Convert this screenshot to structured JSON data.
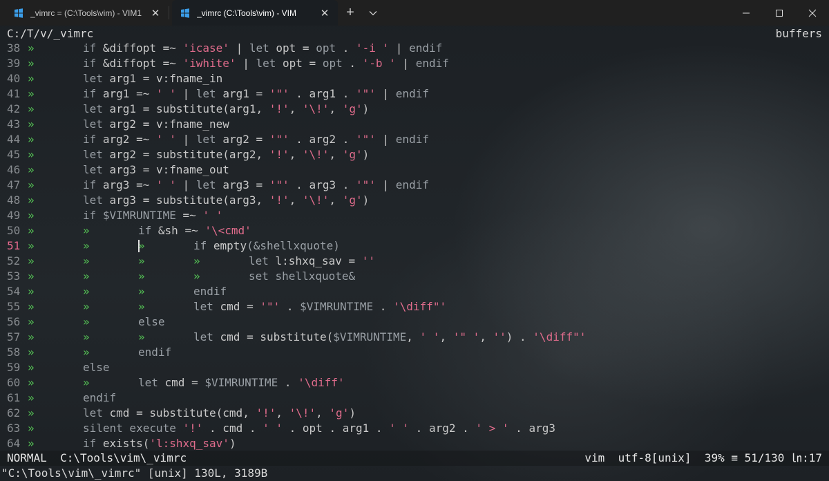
{
  "window": {
    "tabs": [
      {
        "title": "_vimrc = (C:\\Tools\\vim) - VIM1",
        "active": false
      },
      {
        "title": "_vimrc (C:\\Tools\\vim) - VIM",
        "active": true
      }
    ],
    "new_tab_glyph": "+",
    "dropdown_glyph": "⌄",
    "close_glyph": "✕",
    "minimize_glyph": "—",
    "maximize_glyph": "☐",
    "window_close_glyph": "✕"
  },
  "vim": {
    "tabline_path": "C:/T/v/_vimrc",
    "tabline_right": "buffers",
    "guide_glyph": "»",
    "current_line": 51,
    "lines": [
      {
        "n": "38",
        "g": 1,
        "seg": [
          [
            "kw",
            "if "
          ],
          [
            "cmd",
            "&diffopt =~ "
          ],
          [
            "str",
            "'icase'"
          ],
          [
            "cmd",
            " | "
          ],
          [
            "kw",
            "let"
          ],
          [
            "cmd",
            " opt = "
          ],
          [
            "kw",
            "opt"
          ],
          [
            "cmd",
            " . "
          ],
          [
            "str",
            "'-i '"
          ],
          [
            "cmd",
            " | "
          ],
          [
            "kw",
            "endif"
          ]
        ]
      },
      {
        "n": "39",
        "g": 1,
        "seg": [
          [
            "kw",
            "if "
          ],
          [
            "cmd",
            "&diffopt =~ "
          ],
          [
            "str",
            "'iwhite'"
          ],
          [
            "cmd",
            " | "
          ],
          [
            "kw",
            "let"
          ],
          [
            "cmd",
            " opt = "
          ],
          [
            "kw",
            "opt"
          ],
          [
            "cmd",
            " . "
          ],
          [
            "str",
            "'-b '"
          ],
          [
            "cmd",
            " | "
          ],
          [
            "kw",
            "endif"
          ]
        ]
      },
      {
        "n": "40",
        "g": 1,
        "seg": [
          [
            "kw",
            "let "
          ],
          [
            "cmd",
            "arg1 = v:fname_in"
          ]
        ]
      },
      {
        "n": "41",
        "g": 1,
        "seg": [
          [
            "kw",
            "if "
          ],
          [
            "cmd",
            "arg1 =~ "
          ],
          [
            "str",
            "' '"
          ],
          [
            "cmd",
            " | "
          ],
          [
            "kw",
            "let"
          ],
          [
            "cmd",
            " arg1 = "
          ],
          [
            "str",
            "'\"'"
          ],
          [
            "cmd",
            " . arg1 . "
          ],
          [
            "str",
            "'\"'"
          ],
          [
            "cmd",
            " | "
          ],
          [
            "kw",
            "endif"
          ]
        ]
      },
      {
        "n": "42",
        "g": 1,
        "seg": [
          [
            "kw",
            "let "
          ],
          [
            "cmd",
            "arg1 = substitute(arg1, "
          ],
          [
            "str",
            "'!'"
          ],
          [
            "cmd",
            ", "
          ],
          [
            "str",
            "'\\!'"
          ],
          [
            "cmd",
            ", "
          ],
          [
            "str",
            "'g'"
          ],
          [
            "cmd",
            ")"
          ]
        ]
      },
      {
        "n": "43",
        "g": 1,
        "seg": [
          [
            "kw",
            "let "
          ],
          [
            "cmd",
            "arg2 = v:fname_new"
          ]
        ]
      },
      {
        "n": "44",
        "g": 1,
        "seg": [
          [
            "kw",
            "if "
          ],
          [
            "cmd",
            "arg2 =~ "
          ],
          [
            "str",
            "' '"
          ],
          [
            "cmd",
            " | "
          ],
          [
            "kw",
            "let"
          ],
          [
            "cmd",
            " arg2 = "
          ],
          [
            "str",
            "'\"'"
          ],
          [
            "cmd",
            " . arg2 . "
          ],
          [
            "str",
            "'\"'"
          ],
          [
            "cmd",
            " | "
          ],
          [
            "kw",
            "endif"
          ]
        ]
      },
      {
        "n": "45",
        "g": 1,
        "seg": [
          [
            "kw",
            "let "
          ],
          [
            "cmd",
            "arg2 = substitute(arg2, "
          ],
          [
            "str",
            "'!'"
          ],
          [
            "cmd",
            ", "
          ],
          [
            "str",
            "'\\!'"
          ],
          [
            "cmd",
            ", "
          ],
          [
            "str",
            "'g'"
          ],
          [
            "cmd",
            ")"
          ]
        ]
      },
      {
        "n": "46",
        "g": 1,
        "seg": [
          [
            "kw",
            "let "
          ],
          [
            "cmd",
            "arg3 = v:fname_out"
          ]
        ]
      },
      {
        "n": "47",
        "g": 1,
        "seg": [
          [
            "kw",
            "if "
          ],
          [
            "cmd",
            "arg3 =~ "
          ],
          [
            "str",
            "' '"
          ],
          [
            "cmd",
            " | "
          ],
          [
            "kw",
            "let"
          ],
          [
            "cmd",
            " arg3 = "
          ],
          [
            "str",
            "'\"'"
          ],
          [
            "cmd",
            " . arg3 . "
          ],
          [
            "str",
            "'\"'"
          ],
          [
            "cmd",
            " | "
          ],
          [
            "kw",
            "endif"
          ]
        ]
      },
      {
        "n": "48",
        "g": 1,
        "seg": [
          [
            "kw",
            "let "
          ],
          [
            "cmd",
            "arg3 = substitute(arg3, "
          ],
          [
            "str",
            "'!'"
          ],
          [
            "cmd",
            ", "
          ],
          [
            "str",
            "'\\!'"
          ],
          [
            "cmd",
            ", "
          ],
          [
            "str",
            "'g'"
          ],
          [
            "cmd",
            ")"
          ]
        ]
      },
      {
        "n": "49",
        "g": 1,
        "seg": [
          [
            "kw",
            "if "
          ],
          [
            "kw",
            "$VIMRUNTIME"
          ],
          [
            "cmd",
            " =~ "
          ],
          [
            "str",
            "' '"
          ]
        ]
      },
      {
        "n": "50",
        "g": 2,
        "seg": [
          [
            "kw",
            "if "
          ],
          [
            "cmd",
            "&sh =~ "
          ],
          [
            "str",
            "'\\<cmd'"
          ]
        ]
      },
      {
        "n": "51",
        "g": 3,
        "seg": [
          [
            "kw",
            "if "
          ],
          [
            "cmd",
            "empty"
          ],
          [
            "kw",
            "(&shellxquote)"
          ]
        ]
      },
      {
        "n": "52",
        "g": 4,
        "seg": [
          [
            "kw",
            "let "
          ],
          [
            "cmd",
            "l:shxq_sav = "
          ],
          [
            "str",
            "''"
          ]
        ]
      },
      {
        "n": "53",
        "g": 4,
        "seg": [
          [
            "kw",
            "set shellxquote&"
          ]
        ]
      },
      {
        "n": "54",
        "g": 3,
        "seg": [
          [
            "kw",
            "endif"
          ]
        ]
      },
      {
        "n": "55",
        "g": 3,
        "seg": [
          [
            "kw",
            "let "
          ],
          [
            "cmd",
            "cmd = "
          ],
          [
            "str",
            "'\"'"
          ],
          [
            "cmd",
            " . "
          ],
          [
            "kw",
            "$VIMRUNTIME"
          ],
          [
            "cmd",
            " . "
          ],
          [
            "str",
            "'\\diff\"'"
          ]
        ]
      },
      {
        "n": "56",
        "g": 2,
        "seg": [
          [
            "kw",
            "else"
          ]
        ]
      },
      {
        "n": "57",
        "g": 3,
        "seg": [
          [
            "kw",
            "let "
          ],
          [
            "cmd",
            "cmd = substitute("
          ],
          [
            "kw",
            "$VIMRUNTIME"
          ],
          [
            "cmd",
            ", "
          ],
          [
            "str",
            "' '"
          ],
          [
            "cmd",
            ", "
          ],
          [
            "str",
            "'\" '"
          ],
          [
            "cmd",
            ", "
          ],
          [
            "str",
            "''"
          ],
          [
            "cmd",
            ") . "
          ],
          [
            "str",
            "'\\diff\"'"
          ]
        ]
      },
      {
        "n": "58",
        "g": 2,
        "seg": [
          [
            "kw",
            "endif"
          ]
        ]
      },
      {
        "n": "59",
        "g": 1,
        "seg": [
          [
            "kw",
            "else"
          ]
        ]
      },
      {
        "n": "60",
        "g": 2,
        "seg": [
          [
            "kw",
            "let "
          ],
          [
            "cmd",
            "cmd = "
          ],
          [
            "kw",
            "$VIMRUNTIME"
          ],
          [
            "cmd",
            " . "
          ],
          [
            "str",
            "'\\diff'"
          ]
        ]
      },
      {
        "n": "61",
        "g": 1,
        "seg": [
          [
            "kw",
            "endif"
          ]
        ]
      },
      {
        "n": "62",
        "g": 1,
        "seg": [
          [
            "kw",
            "let "
          ],
          [
            "cmd",
            "cmd = substitute(cmd, "
          ],
          [
            "str",
            "'!'"
          ],
          [
            "cmd",
            ", "
          ],
          [
            "str",
            "'\\!'"
          ],
          [
            "cmd",
            ", "
          ],
          [
            "str",
            "'g'"
          ],
          [
            "cmd",
            ")"
          ]
        ]
      },
      {
        "n": "63",
        "g": 1,
        "seg": [
          [
            "kw",
            "silent execute "
          ],
          [
            "str",
            "'!'"
          ],
          [
            "cmd",
            " . cmd . "
          ],
          [
            "str",
            "' '"
          ],
          [
            "cmd",
            " . opt . arg1 . "
          ],
          [
            "str",
            "' '"
          ],
          [
            "cmd",
            " . arg2 . "
          ],
          [
            "str",
            "' > '"
          ],
          [
            "cmd",
            " . arg3"
          ]
        ]
      },
      {
        "n": "64",
        "g": 1,
        "seg": [
          [
            "kw",
            "if "
          ],
          [
            "cmd",
            "exists("
          ],
          [
            "str",
            "'l:shxq_sav'"
          ],
          [
            "cmd",
            ")"
          ]
        ]
      }
    ],
    "status": {
      "mode": "NORMAL",
      "path": "C:\\Tools\\vim\\_vimrc",
      "filetype": "vim",
      "encoding": "utf-8[unix]",
      "percent": "39%",
      "position_glyph": "≡",
      "line_pos": "51/130",
      "col_glyph": "㏑",
      "col": ":17"
    },
    "cmdline": "\"C:\\Tools\\vim\\_vimrc\" [unix] 130L, 3189B"
  }
}
